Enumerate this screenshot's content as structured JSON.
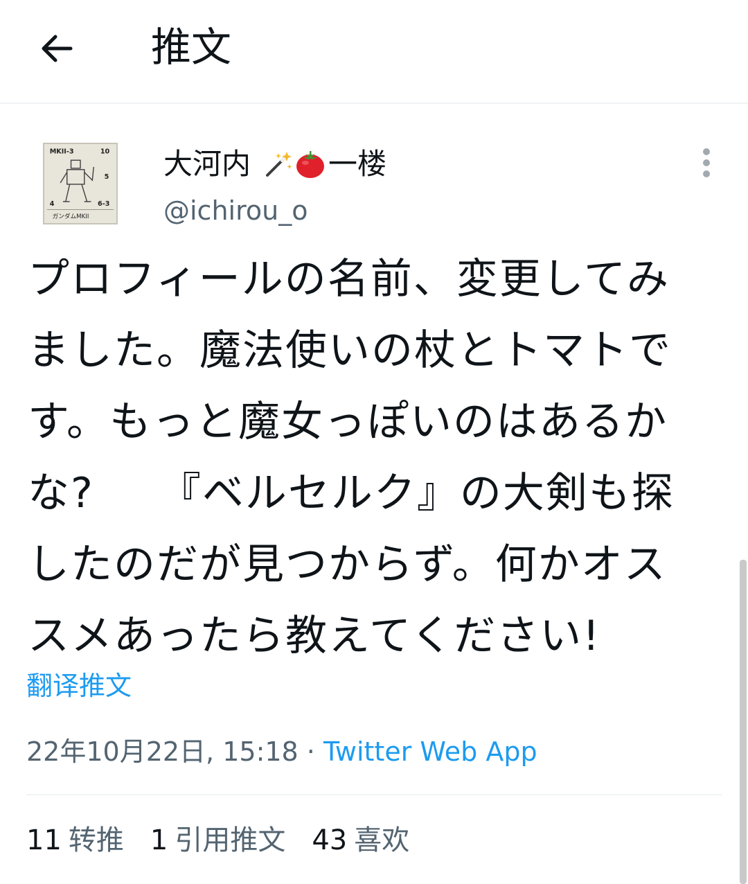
{
  "header": {
    "title": "推文",
    "back_icon": "arrow-left-icon"
  },
  "tweet": {
    "avatar_text": {
      "top_left": "MKII-3",
      "top_right": "10",
      "mid_right": "5",
      "bottom_left": "4",
      "bottom_right": "6-3",
      "caption": "ガンダムMKII"
    },
    "display_name": "大河内",
    "name_emojis": [
      "magic-wand-icon",
      "tomato-icon"
    ],
    "name_suffix": "一楼",
    "handle": "@ichirou_o",
    "text_lines": [
      "プロフィールの名前、変更してみ",
      "ました。魔法使いの杖とトマトで",
      "す。もっと魔女っぽいのはあるか",
      "な?　　『ベルセルク』の大剣も探",
      "したのだが見つからず。何かオス",
      "スメあったら教えてください!"
    ],
    "translate_label": "翻译推文",
    "timestamp": "22年10月22日, 15:18 · ",
    "source": "Twitter Web App",
    "stats": [
      {
        "count": "11",
        "label": "转推"
      },
      {
        "count": "1",
        "label": "引用推文"
      },
      {
        "count": "43",
        "label": "喜欢"
      }
    ]
  },
  "colors": {
    "text": "#0f1419",
    "secondary": "#536471",
    "link": "#1d9bf0",
    "divider": "#eff3f4"
  }
}
